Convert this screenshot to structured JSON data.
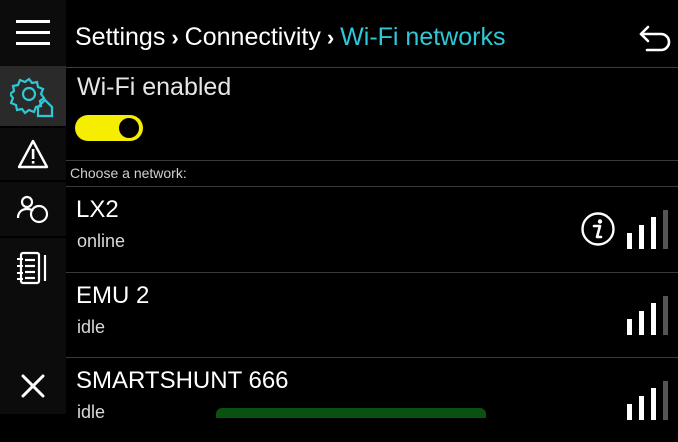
{
  "header": {
    "breadcrumb": [
      "Settings",
      "Connectivity",
      "Wi-Fi networks"
    ],
    "separator": "›"
  },
  "wifi": {
    "label": "Wi-Fi enabled",
    "enabled": true
  },
  "networks_section": {
    "label": "Choose a network:"
  },
  "networks": [
    {
      "name": "LX2",
      "status": "online",
      "has_info": true,
      "signal_bars": 3
    },
    {
      "name": "EMU 2",
      "status": "idle",
      "has_info": false,
      "signal_bars": 3
    },
    {
      "name": "SMARTSHUNT 666",
      "status": "idle",
      "has_info": false,
      "signal_bars": 3
    }
  ],
  "sidebar": {
    "items": [
      {
        "icon": "menu-icon"
      },
      {
        "icon": "settings-home-icon",
        "active": true
      },
      {
        "icon": "warning-icon"
      },
      {
        "icon": "users-icon"
      },
      {
        "icon": "notebook-icon"
      },
      {
        "icon": "close-icon"
      }
    ]
  },
  "colors": {
    "accent": "#2ec8d6",
    "toggle_on": "#f5ee00",
    "background": "#000000",
    "rail": "#0c0c0c",
    "active_rail": "#2a2a2a"
  }
}
